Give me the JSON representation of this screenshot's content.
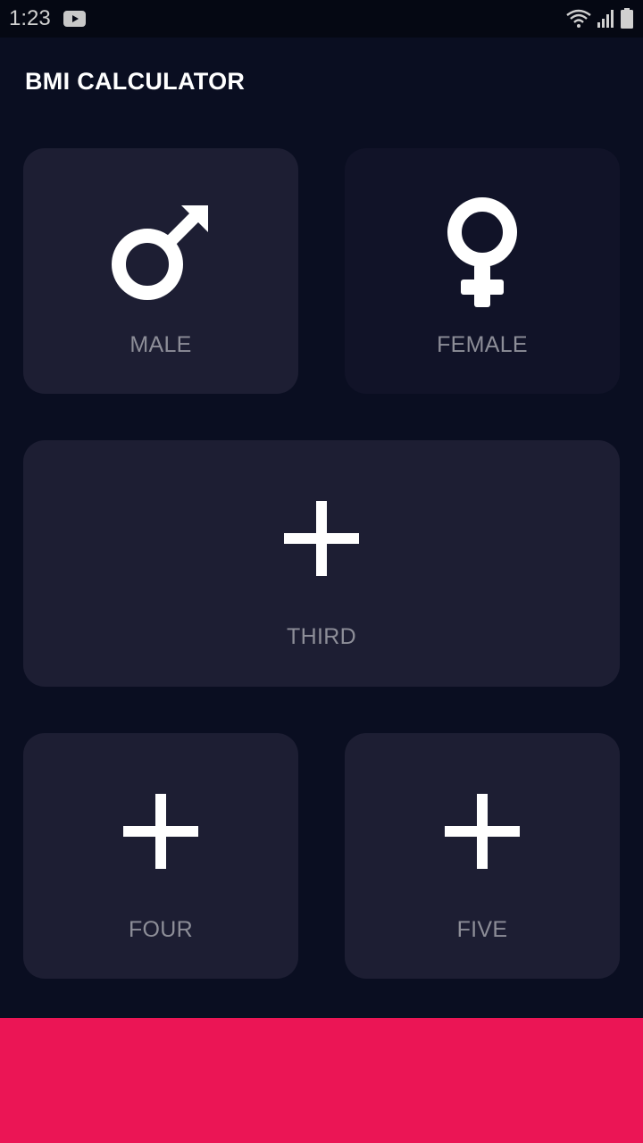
{
  "status_bar": {
    "time": "1:23",
    "icons": [
      "youtube-icon",
      "wifi-icon",
      "signal-icon",
      "battery-icon"
    ]
  },
  "app_bar": {
    "title": "BMI CALCULATOR"
  },
  "cards": {
    "male": {
      "label": "MALE",
      "icon": "male-symbol-icon"
    },
    "female": {
      "label": "FEMALE",
      "icon": "female-symbol-icon"
    },
    "third": {
      "label": "THIRD",
      "icon": "plus-icon"
    },
    "four": {
      "label": "FOUR",
      "icon": "plus-icon"
    },
    "five": {
      "label": "FIVE",
      "icon": "plus-icon"
    }
  },
  "colors": {
    "background": "#0a0e21",
    "active_card": "#1d1e33",
    "inactive_card": "#111328",
    "label": "#8d8e98",
    "accent": "#eb1555"
  }
}
